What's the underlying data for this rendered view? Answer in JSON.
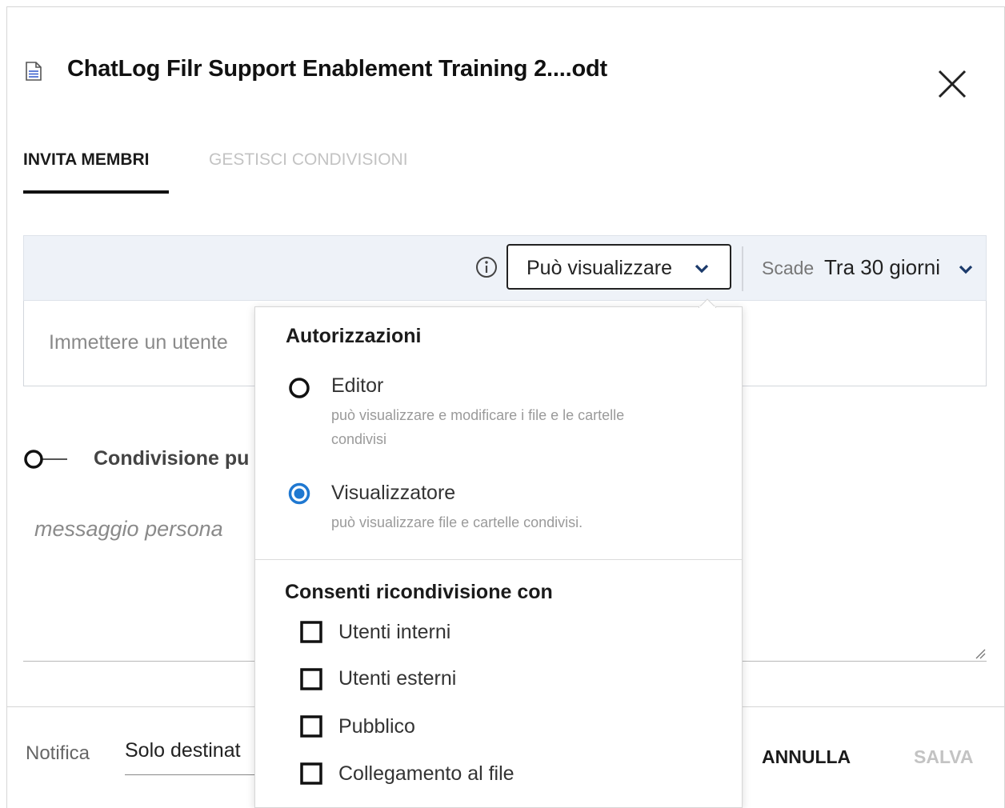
{
  "dialog": {
    "title": "ChatLog Filr Support Enablement Training 2....odt",
    "tabs": [
      {
        "label": "INVITA MEMBRI",
        "active": true
      },
      {
        "label": "GESTISCI CONDIVISIONI",
        "active": false
      }
    ]
  },
  "toolbar": {
    "permission_label": "Può visualizzare",
    "expire_label": "Scade",
    "expire_value": "Tra 30 giorni"
  },
  "user_input": {
    "placeholder": "Immettere un utente"
  },
  "public_share": {
    "label": "Condivisione pu"
  },
  "message": {
    "placeholder": "messaggio persona"
  },
  "footer": {
    "notify_label": "Notifica",
    "notify_value": "Solo destinat",
    "cancel_label": "ANNULLA",
    "save_label": "SALVA"
  },
  "permissions_popover": {
    "heading": "Autorizzazioni",
    "options": [
      {
        "title": "Editor",
        "description_line1": "può visualizzare e modificare i file e le cartelle",
        "description_line2": "condivisi",
        "selected": false
      },
      {
        "title": "Visualizzatore",
        "description_line1": "può visualizzare file e cartelle condivisi.",
        "selected": true
      }
    ],
    "reshare_heading": "Consenti ricondivisione con",
    "reshare_options": [
      {
        "label": "Utenti interni",
        "checked": false
      },
      {
        "label": "Utenti esterni",
        "checked": false
      },
      {
        "label": "Pubblico",
        "checked": false
      },
      {
        "label": "Collegamento al file",
        "checked": false
      }
    ]
  },
  "colors": {
    "accent": "#1f78d1",
    "toolbar_bg": "#eef2f8",
    "disabled_text": "#c3c3c3"
  },
  "icons": [
    "document-icon",
    "close-icon",
    "info-icon",
    "chevron-down-icon"
  ]
}
